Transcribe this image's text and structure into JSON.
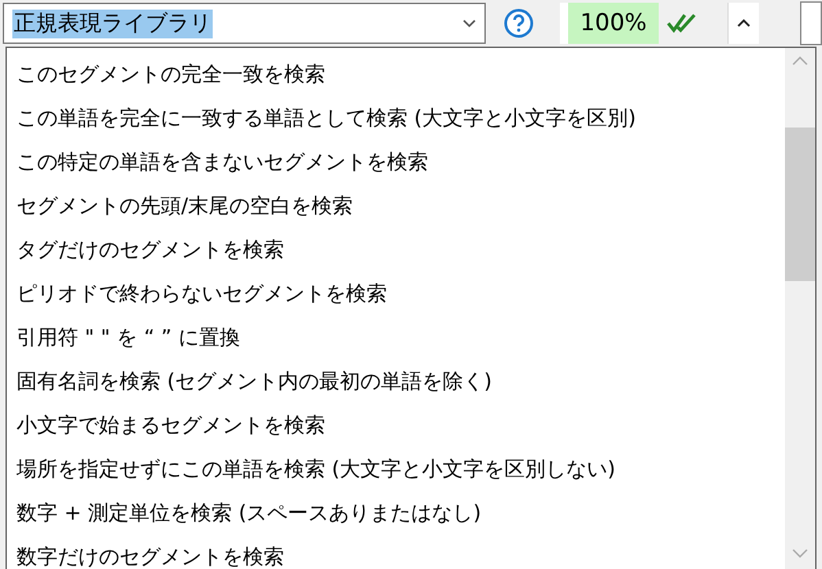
{
  "toolbar": {
    "library_combo": {
      "value": "正規表現ライブラリ",
      "text_selected": true
    },
    "zoom": {
      "value": "100%"
    }
  },
  "dropdown": {
    "items": [
      {
        "label": "このセグメントの完全一致を検索"
      },
      {
        "label": "この単語を完全に一致する単語として検索 (大文字と小文字を区別)"
      },
      {
        "label": "この特定の単語を含まないセグメントを検索"
      },
      {
        "label": "セグメントの先頭/末尾の空白を検索"
      },
      {
        "label": "タグだけのセグメントを検索"
      },
      {
        "label": "ピリオドで終わらないセグメントを検索"
      },
      {
        "label": "引用符 \" \" を “ ” に置換"
      },
      {
        "label": "固有名詞を検索 (セグメント内の最初の単語を除く)"
      },
      {
        "label": "小文字で始まるセグメントを検索"
      },
      {
        "label": "場所を指定せずにこの単語を検索 (大文字と小文字を区別しない)"
      },
      {
        "label": "数字 + 測定単位を検索 (スペースありまたはなし)"
      },
      {
        "label": "数字だけのセグメントを検索"
      }
    ]
  }
}
